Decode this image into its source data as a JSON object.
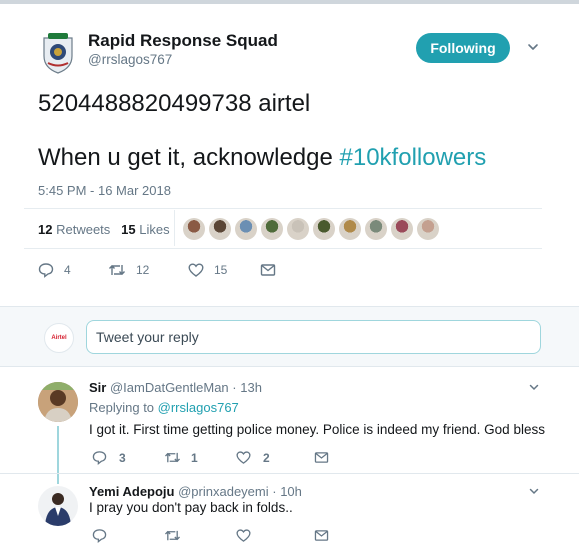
{
  "tweet": {
    "author_name": "Rapid Response Squad",
    "author_handle": "@rrslagos767",
    "follow_label": "Following",
    "text_line1": "5204488820499738 airtel",
    "text_line2_prefix": "When u get it, acknowledge ",
    "hashtag": "#10kfollowers",
    "timestamp": "5:45 PM - 16 Mar 2018",
    "retweets_count": "12",
    "retweets_label": "Retweets",
    "likes_count": "15",
    "likes_label": "Likes",
    "actions": {
      "replies": "4",
      "retweets": "12",
      "likes": "15"
    }
  },
  "reply_box": {
    "placeholder": "Tweet your reply",
    "avatar_text": "Airtel"
  },
  "replies": [
    {
      "name": "Sir",
      "handle": "@IamDatGentleMan",
      "time": "· 13h",
      "replying_prefix": "Replying to ",
      "replying_to": "@rrslagos767",
      "text": "I got it. First time getting police money. Police is indeed my friend. God bless",
      "replies": "3",
      "retweets": "1",
      "likes": "2"
    },
    {
      "name": "Yemi Adepoju",
      "handle": "@prinxadeyemi",
      "time": "· 10h",
      "text": "I pray you don't pay back in folds..",
      "replies": "",
      "retweets": "",
      "likes": ""
    }
  ],
  "colors": {
    "accent": "#21a0b0",
    "muted": "#657786",
    "text": "#14171a",
    "divider": "#e6ecf0"
  },
  "liker_avatars": [
    "#8a5a44",
    "#5b4636",
    "#6b8fb3",
    "#4f6b3a",
    "#c9c2b8",
    "#4a5a2e",
    "#b08a4a",
    "#7a8a7a",
    "#9a4a5a",
    "#c4a090"
  ]
}
